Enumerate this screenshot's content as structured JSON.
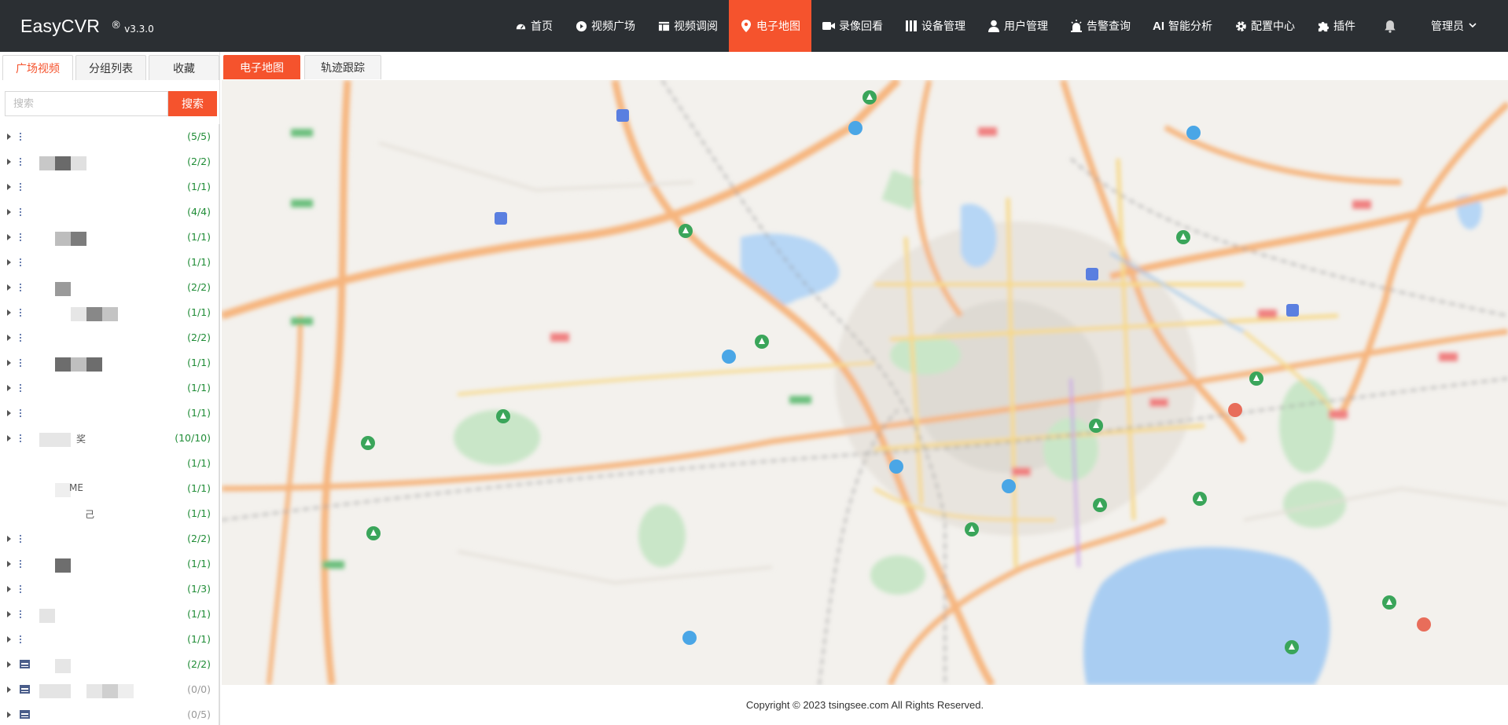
{
  "app": {
    "name": "EasyCVR",
    "reg": "®",
    "version": "v3.3.0"
  },
  "nav": {
    "items": [
      {
        "label": "首页",
        "icon": "dashboard-icon"
      },
      {
        "label": "视频广场",
        "icon": "play-circle-icon"
      },
      {
        "label": "视频调阅",
        "icon": "grid-layout-icon"
      },
      {
        "label": "电子地图",
        "icon": "map-pin-icon"
      },
      {
        "label": "录像回看",
        "icon": "video-camera-icon"
      },
      {
        "label": "设备管理",
        "icon": "devices-icon"
      },
      {
        "label": "用户管理",
        "icon": "user-icon"
      },
      {
        "label": "告警查询",
        "icon": "alarm-icon"
      },
      {
        "label": "智能分析",
        "icon": "ai-icon"
      },
      {
        "label": "配置中心",
        "icon": "gear-icon"
      },
      {
        "label": "插件",
        "icon": "puzzle-icon"
      }
    ],
    "active_index": 3,
    "ai_badge": "AI",
    "user_label": "管理员"
  },
  "left_tabs": [
    "广场视频",
    "分组列表",
    "收藏"
  ],
  "search": {
    "placeholder": "搜索",
    "button": "搜索"
  },
  "tree": {
    "counts": [
      "(5/5)",
      "(2/2)",
      "(1/1)",
      "(4/4)",
      "(1/1)",
      "(1/1)",
      "(2/2)",
      "(1/1)",
      "(2/2)",
      "(1/1)",
      "(1/1)",
      "(1/1)",
      "(10/10)",
      "(1/1)",
      "(1/1)",
      "(1/1)",
      "(2/2)",
      "(1/1)",
      "(1/3)",
      "(1/1)",
      "(1/1)",
      "(2/2)",
      "(0/0)",
      "(0/5)"
    ],
    "stub_labels": {
      "row12": "奖",
      "row14": "ME",
      "row15": "己"
    }
  },
  "right_tabs": [
    "电子地图",
    "轨迹跟踪"
  ],
  "footer": {
    "copyright": "Copyright © 2023 tsingsee.com All Rights Reserved."
  },
  "colors": {
    "topbar": "#2b2f33",
    "accent": "#f5532d",
    "count_green": "#1f8c36"
  }
}
